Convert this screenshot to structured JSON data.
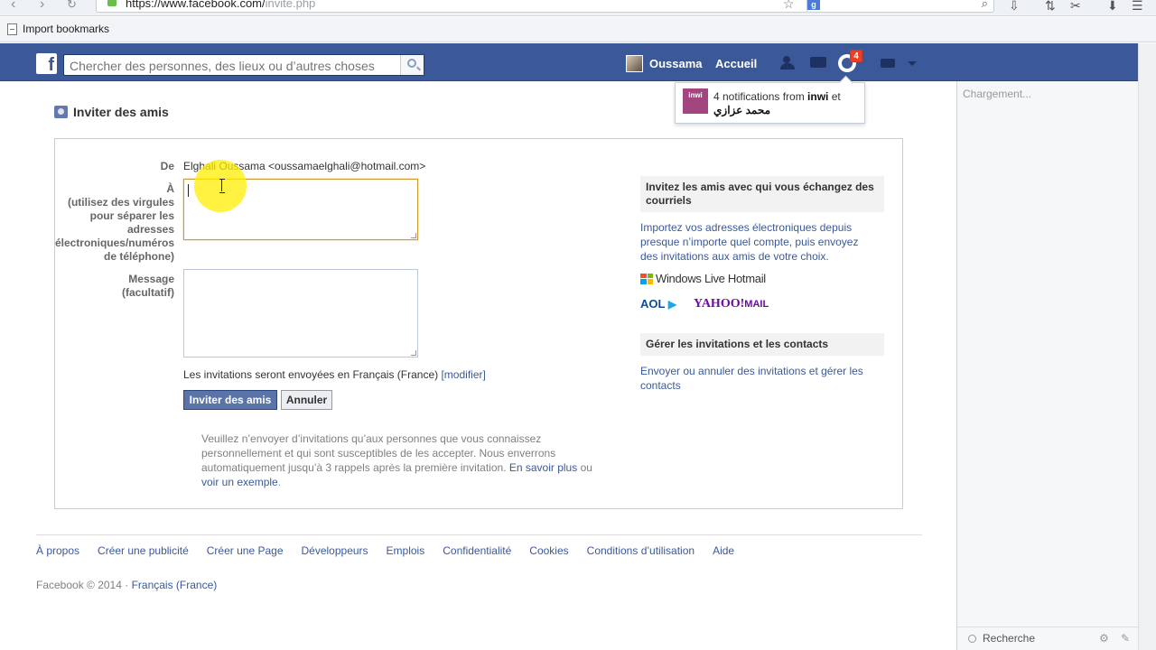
{
  "browser": {
    "url_main": "https://www.facebook.com/",
    "url_path": "invite.php",
    "bookmark_label": "Import bookmarks"
  },
  "fb_header": {
    "search_placeholder": "Chercher des personnes, des lieux ou d’autres choses",
    "user_name": "Oussama",
    "home_label": "Accueil",
    "notif_count": "4"
  },
  "notification_popup": {
    "thumb_text": "inwi",
    "text_prefix": "4 notifications from ",
    "text_bold": "inwi",
    "text_suffix": " et",
    "second_line": "محمد عزازي"
  },
  "page": {
    "title": "Inviter des amis"
  },
  "form": {
    "from_label": "De",
    "from_value": "Elghali Oussama <oussamaelghali@hotmail.com>",
    "to_label": "À",
    "to_hint": "(utilisez des virgules pour séparer les adresses électroniques/numéros de téléphone)",
    "message_label": "Message",
    "message_hint": "(facultatif)",
    "lang_text": "Les invitations seront envoyées en Français (France) ",
    "lang_link": "[modifier]",
    "invite_button": "Inviter des amis",
    "cancel_button": "Annuler",
    "disclaimer_text": "Veuillez n’envoyer d’invitations qu’aux personnes que vous connaissez personnellement et qui sont susceptibles de les accepter. Nous enverrons automatiquement jusqu’à 3 rappels après la première invitation. ",
    "learn_more": "En savoir plus",
    "or_text": " ou ",
    "see_example": "voir un exemple",
    "period": "."
  },
  "right_panel": {
    "heading_1": "Invitez les amis avec qui vous échangez des courriels",
    "description": "Importez vos adresses électroniques depuis presque n’importe quel compte, puis envoyez des invitations aux amis de votre choix.",
    "hotmail_logo": "Windows Live Hotmail",
    "aol_logo": "AOL",
    "yahoo_logo": "YAHOO!",
    "yahoo_suffix": "MAIL",
    "heading_2": "Gérer les invitations et les contacts",
    "manage_link": "Envoyer ou annuler des invitations et gérer les contacts"
  },
  "chat": {
    "loading": "Chargement...",
    "search_label": "Recherche"
  },
  "footer": {
    "links": [
      "À propos",
      "Créer une publicité",
      "Créer une Page",
      "Développeurs",
      "Emplois",
      "Confidentialité",
      "Cookies",
      "Conditions d’utilisation",
      "Aide"
    ],
    "copyright": "Facebook © 2014 · ",
    "language_link": "Français (France)"
  },
  "colors": {
    "fb_blue": "#3b5998",
    "link_blue": "#3b5998",
    "badge_red": "#f03d25",
    "focus_border": "#c89d2f"
  }
}
